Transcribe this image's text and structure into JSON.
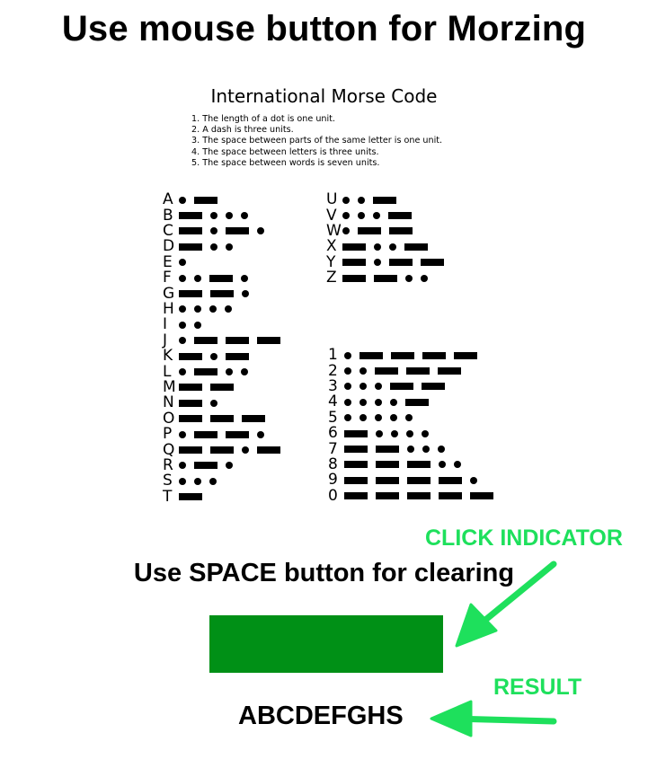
{
  "page": {
    "title": "Use mouse button for Morzing",
    "clear_hint": "Use SPACE button for clearing",
    "result_text": "ABCDEFGHS",
    "indicator_color": "#009016"
  },
  "morse_chart": {
    "title": "International Morse Code",
    "rules": [
      "1. The length of a dot is one unit.",
      "2. A dash is three units.",
      "3. The space between parts of the same letter is one unit.",
      "4. The space between letters is three units.",
      "5. The space between words is seven units."
    ],
    "left_column": [
      {
        "char": "A",
        "code": ".-"
      },
      {
        "char": "B",
        "code": "-..."
      },
      {
        "char": "C",
        "code": "-.-."
      },
      {
        "char": "D",
        "code": "-.."
      },
      {
        "char": "E",
        "code": "."
      },
      {
        "char": "F",
        "code": "..-."
      },
      {
        "char": "G",
        "code": "--."
      },
      {
        "char": "H",
        "code": "...."
      },
      {
        "char": "I",
        "code": ".."
      },
      {
        "char": "J",
        "code": ".---"
      },
      {
        "char": "K",
        "code": "-.-"
      },
      {
        "char": "L",
        "code": ".-.."
      },
      {
        "char": "M",
        "code": "--"
      },
      {
        "char": "N",
        "code": "-."
      },
      {
        "char": "O",
        "code": "---"
      },
      {
        "char": "P",
        "code": ".--."
      },
      {
        "char": "Q",
        "code": "--.-"
      },
      {
        "char": "R",
        "code": ".-."
      },
      {
        "char": "S",
        "code": "..."
      },
      {
        "char": "T",
        "code": "-"
      }
    ],
    "right_letters": [
      {
        "char": "U",
        "code": "..-"
      },
      {
        "char": "V",
        "code": "...-"
      },
      {
        "char": "W",
        "code": ".--"
      },
      {
        "char": "X",
        "code": "-..-"
      },
      {
        "char": "Y",
        "code": "-.--"
      },
      {
        "char": "Z",
        "code": "--.."
      }
    ],
    "right_digits": [
      {
        "char": "1",
        "code": ".----"
      },
      {
        "char": "2",
        "code": "..---"
      },
      {
        "char": "3",
        "code": "...--"
      },
      {
        "char": "4",
        "code": "....-"
      },
      {
        "char": "5",
        "code": "....."
      },
      {
        "char": "6",
        "code": "-...."
      },
      {
        "char": "7",
        "code": "--..."
      },
      {
        "char": "8",
        "code": "---.."
      },
      {
        "char": "9",
        "code": "----."
      },
      {
        "char": "0",
        "code": "-----"
      }
    ]
  },
  "annotations": {
    "click_indicator_label": "CLICK INDICATOR",
    "result_label": "RESULT",
    "color": "#1ee05c"
  }
}
